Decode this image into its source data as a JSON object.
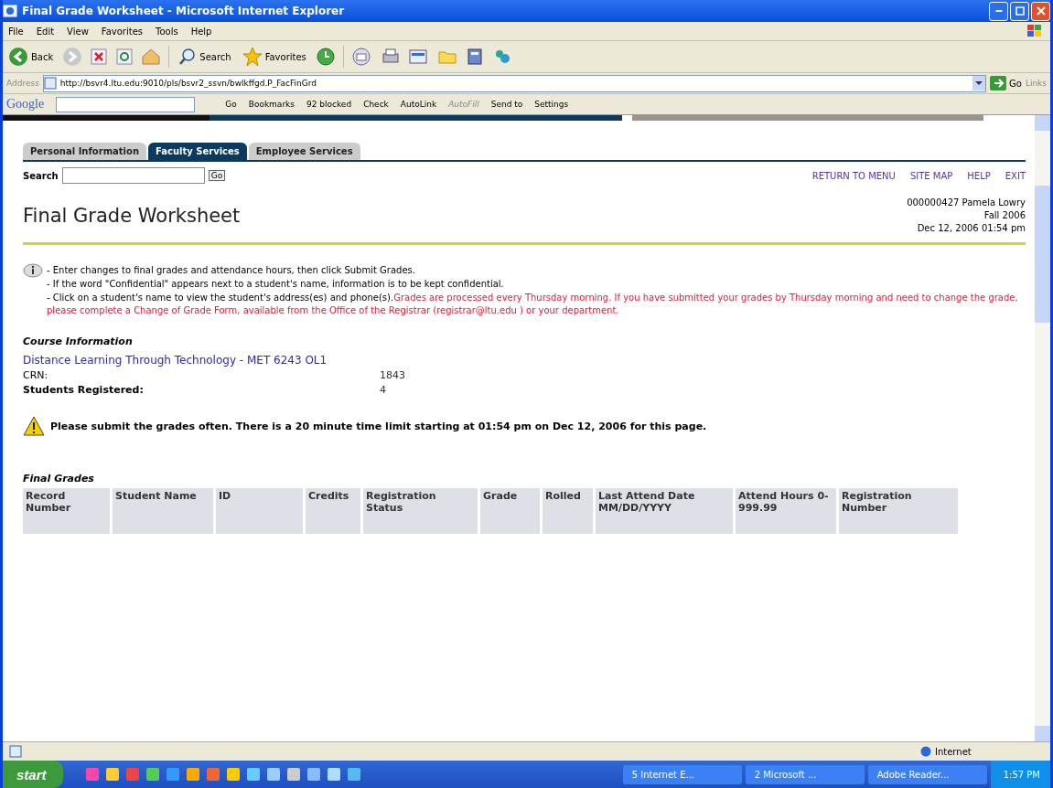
{
  "window": {
    "title": "Final Grade Worksheet - Microsoft Internet Explorer"
  },
  "menu": [
    "File",
    "Edit",
    "View",
    "Favorites",
    "Tools",
    "Help"
  ],
  "toolbar": {
    "back": "Back",
    "search": "Search",
    "favorites": "Favorites"
  },
  "address": {
    "label": "Address",
    "url": "http://bsvr4.ltu.edu:9010/pls/bsvr2_ssvn/bwlkffgd.P_FacFinGrd",
    "go": "Go",
    "links": "Links"
  },
  "google_bar": {
    "logo": "Google",
    "items": [
      {
        "label": "Go",
        "disabled": false
      },
      {
        "label": "Bookmarks",
        "disabled": false
      },
      {
        "label": "92 blocked",
        "disabled": false
      },
      {
        "label": "Check",
        "disabled": false
      },
      {
        "label": "AutoLink",
        "disabled": false
      },
      {
        "label": "AutoFill",
        "disabled": true
      },
      {
        "label": "Send to",
        "disabled": false
      },
      {
        "label": "Settings",
        "disabled": false
      }
    ]
  },
  "tabs": [
    {
      "label": "Personal Information",
      "selected": false
    },
    {
      "label": "Faculty Services",
      "selected": true
    },
    {
      "label": "Employee Services",
      "selected": false
    }
  ],
  "search": {
    "label": "Search",
    "button": "Go"
  },
  "nav_links": [
    "RETURN TO MENU",
    "SITE MAP",
    "HELP",
    "EXIT"
  ],
  "page_title": "Final Grade Worksheet",
  "user_info": [
    "000000427 Pamela Lowry",
    "Fall 2006",
    "Dec 12, 2006 01:54 pm"
  ],
  "instructions": [
    {
      "text": "- Enter changes to final grades and attendance hours, then click Submit Grades."
    },
    {
      "text": "- If the word \"Confidential\" appears next to a student's name, information is to be kept confidential."
    },
    {
      "text": "- Click on a student's name to view the student's address(es) and phone(s).",
      "note": "Grades are processed every Thursday morning. If you have submitted your grades by Thursday morning and need to change the grade, please complete a Change of Grade Form, available from the Office of the Registrar (registrar@ltu.edu ) or your department."
    }
  ],
  "course": {
    "heading": "Course Information",
    "title": "Distance Learning Through Technology - MET 6243 OL1",
    "fields": [
      {
        "label": "CRN:",
        "value": "1843"
      },
      {
        "label": "Students Registered:",
        "value": "4"
      }
    ]
  },
  "warning": "Please submit the grades often. There is a 20 minute time limit starting at 01:54 pm on Dec 12, 2006 for this page.",
  "final_grades": {
    "heading": "Final Grades",
    "columns": [
      "Record Number",
      "Student Name",
      "ID",
      "Credits",
      "Registration Status",
      "Grade",
      "Rolled",
      "Last Attend Date MM/DD/YYYY",
      "Attend Hours 0-999.99",
      "Registration Number"
    ]
  },
  "status_bar": {
    "zone": "Internet"
  },
  "taskbar": {
    "start": "start",
    "tasks": [
      "5 Internet E...",
      "2 Microsoft ...",
      "Adobe Reader..."
    ],
    "clock": "1:57 PM"
  }
}
